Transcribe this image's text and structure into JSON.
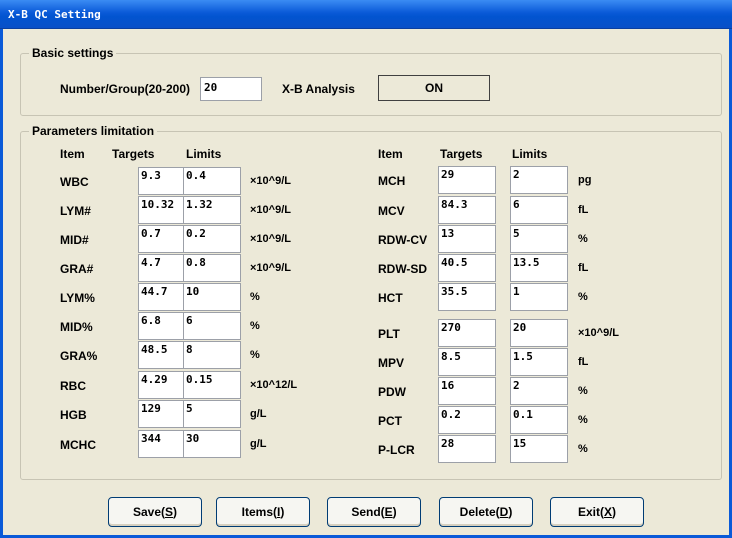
{
  "window": {
    "title": "X-B QC Setting"
  },
  "basic": {
    "legend": "Basic settings",
    "number_label": "Number/Group(20-200)",
    "number_value": "20",
    "analysis_label": "X-B Analysis",
    "analysis_value": "ON"
  },
  "params": {
    "legend": "Parameters limitation",
    "headers": {
      "item": "Item",
      "targets": "Targets",
      "limits": "Limits"
    },
    "left": [
      {
        "item": "WBC",
        "target": "9.3",
        "limit": "0.4",
        "unit": "×10^9/L"
      },
      {
        "item": "LYM#",
        "target": "10.32",
        "limit": "1.32",
        "unit": "×10^9/L"
      },
      {
        "item": "MID#",
        "target": "0.7",
        "limit": "0.2",
        "unit": "×10^9/L"
      },
      {
        "item": "GRA#",
        "target": "4.7",
        "limit": "0.8",
        "unit": "×10^9/L"
      },
      {
        "item": "LYM%",
        "target": "44.7",
        "limit": "10",
        "unit": "%"
      },
      {
        "item": "MID%",
        "target": "6.8",
        "limit": "6",
        "unit": "%"
      },
      {
        "item": "GRA%",
        "target": "48.5",
        "limit": "8",
        "unit": "%"
      },
      {
        "item": "RBC",
        "target": "4.29",
        "limit": "0.15",
        "unit": "×10^12/L"
      },
      {
        "item": "HGB",
        "target": "129",
        "limit": "5",
        "unit": "g/L"
      },
      {
        "item": "MCHC",
        "target": "344",
        "limit": "30",
        "unit": "g/L"
      }
    ],
    "right": [
      {
        "item": "MCH",
        "target": "29",
        "limit": "2",
        "unit": "pg"
      },
      {
        "item": "MCV",
        "target": "84.3",
        "limit": "6",
        "unit": "fL"
      },
      {
        "item": "RDW-CV",
        "target": "13",
        "limit": "5",
        "unit": "%"
      },
      {
        "item": "RDW-SD",
        "target": "40.5",
        "limit": "13.5",
        "unit": "fL"
      },
      {
        "item": "HCT",
        "target": "35.5",
        "limit": "1",
        "unit": "%"
      },
      {
        "item": "PLT",
        "target": "270",
        "limit": "20",
        "unit": "×10^9/L"
      },
      {
        "item": "MPV",
        "target": "8.5",
        "limit": "1.5",
        "unit": "fL"
      },
      {
        "item": "PDW",
        "target": "16",
        "limit": "2",
        "unit": "%"
      },
      {
        "item": "PCT",
        "target": "0.2",
        "limit": "0.1",
        "unit": "%"
      },
      {
        "item": "P-LCR",
        "target": "28",
        "limit": "15",
        "unit": "%"
      }
    ]
  },
  "buttons": {
    "save": {
      "pre": "Save(",
      "key": "S",
      "post": ")"
    },
    "items": {
      "pre": "Items(",
      "key": "I",
      "post": ")"
    },
    "send": {
      "pre": "Send(",
      "key": "E",
      "post": ")"
    },
    "delete": {
      "pre": "Delete(",
      "key": "D",
      "post": ")"
    },
    "exit": {
      "pre": "Exit(",
      "key": "X",
      "post": ")"
    }
  }
}
